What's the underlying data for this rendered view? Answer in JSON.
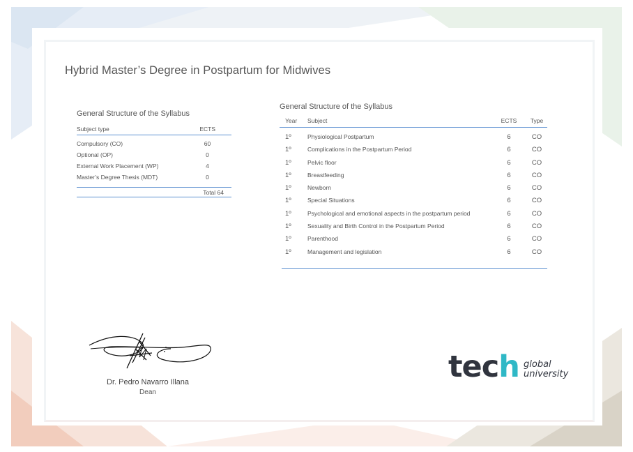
{
  "document_title": "Hybrid Master’s Degree in Postpartum for Midwives",
  "summary": {
    "title": "General Structure of the Syllabus",
    "col_type": "Subject type",
    "col_ects": "ECTS",
    "rows": [
      {
        "label": "Compulsory (CO)",
        "ects": "60"
      },
      {
        "label": "Optional (OP)",
        "ects": "0"
      },
      {
        "label": "External Work Placement (WP)",
        "ects": "4"
      },
      {
        "label": "Master’s Degree Thesis (MDT)",
        "ects": "0"
      }
    ],
    "total": "Total 64"
  },
  "syllabus": {
    "title": "General Structure of the Syllabus",
    "col_year": "Year",
    "col_subject": "Subject",
    "col_ects": "ECTS",
    "col_type": "Type",
    "rows": [
      {
        "year": "1º",
        "subject": "Physiological Postpartum",
        "ects": "6",
        "type": "CO"
      },
      {
        "year": "1º",
        "subject": "Complications in the Postpartum Period",
        "ects": "6",
        "type": "CO"
      },
      {
        "year": "1º",
        "subject": "Pelvic floor",
        "ects": "6",
        "type": "CO"
      },
      {
        "year": "1º",
        "subject": "Breastfeeding",
        "ects": "6",
        "type": "CO"
      },
      {
        "year": "1º",
        "subject": "Newborn",
        "ects": "6",
        "type": "CO"
      },
      {
        "year": "1º",
        "subject": "Special Situations",
        "ects": "6",
        "type": "CO"
      },
      {
        "year": "1º",
        "subject": "Psychological and emotional aspects in the postpartum period",
        "ects": "6",
        "type": "CO"
      },
      {
        "year": "1º",
        "subject": "Sexuality and Birth Control in the Postpartum Period",
        "ects": "6",
        "type": "CO"
      },
      {
        "year": "1º",
        "subject": "Parenthood",
        "ects": "6",
        "type": "CO"
      },
      {
        "year": "1º",
        "subject": "Management and legislation",
        "ects": "6",
        "type": "CO"
      }
    ]
  },
  "signatory": {
    "name": "Dr. Pedro Navarro Illana",
    "role": "Dean"
  },
  "logo": {
    "word": "tec",
    "letter": "h",
    "line1": "global",
    "line2": "university"
  }
}
